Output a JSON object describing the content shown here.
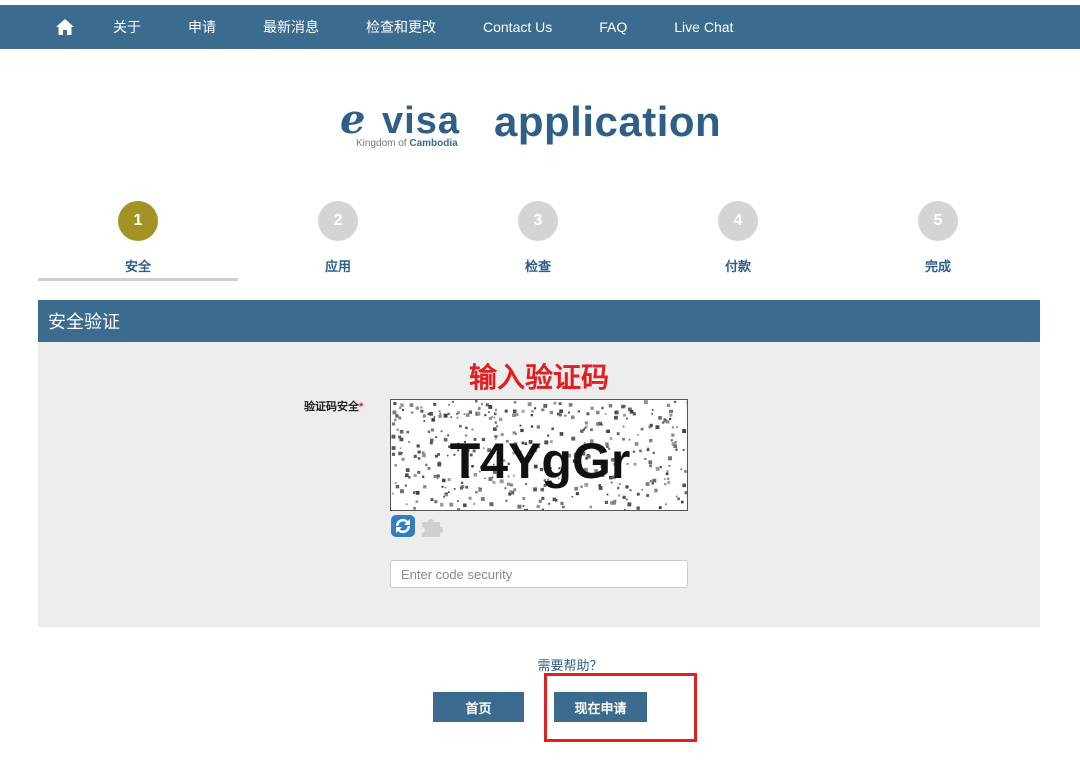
{
  "nav": {
    "home_icon": "home-icon",
    "items": [
      "关于",
      "申请",
      "最新消息",
      "检查和更改",
      "Contact Us",
      "FAQ",
      "Live Chat"
    ]
  },
  "logo": {
    "mark": "e",
    "visa": "visa",
    "subtitle_prefix": "Kingdom of",
    "subtitle_bold": "Cambodia",
    "application": "application"
  },
  "steps": [
    {
      "number": "1",
      "label": "安全",
      "active": true
    },
    {
      "number": "2",
      "label": "应用",
      "active": false
    },
    {
      "number": "3",
      "label": "检查",
      "active": false
    },
    {
      "number": "4",
      "label": "付款",
      "active": false
    },
    {
      "number": "5",
      "label": "完成",
      "active": false
    }
  ],
  "section": {
    "title": "安全验证",
    "captcha_heading": "输入验证码",
    "captcha_label": "验证码安全",
    "required_mark": "*",
    "captcha_text": "T4YgGr",
    "refresh_icon": "refresh-icon",
    "audio_icon": "puzzle-icon",
    "input_placeholder": "Enter code security",
    "input_value": ""
  },
  "footer": {
    "help": "需要帮助？",
    "home_button": "首页",
    "apply_button": "现在申请"
  },
  "colors": {
    "primary": "#3b6b8f",
    "active_step": "#a39325",
    "inactive_step": "#d4d4d4",
    "heading_red": "#e02020",
    "highlight": "#dd2020"
  }
}
